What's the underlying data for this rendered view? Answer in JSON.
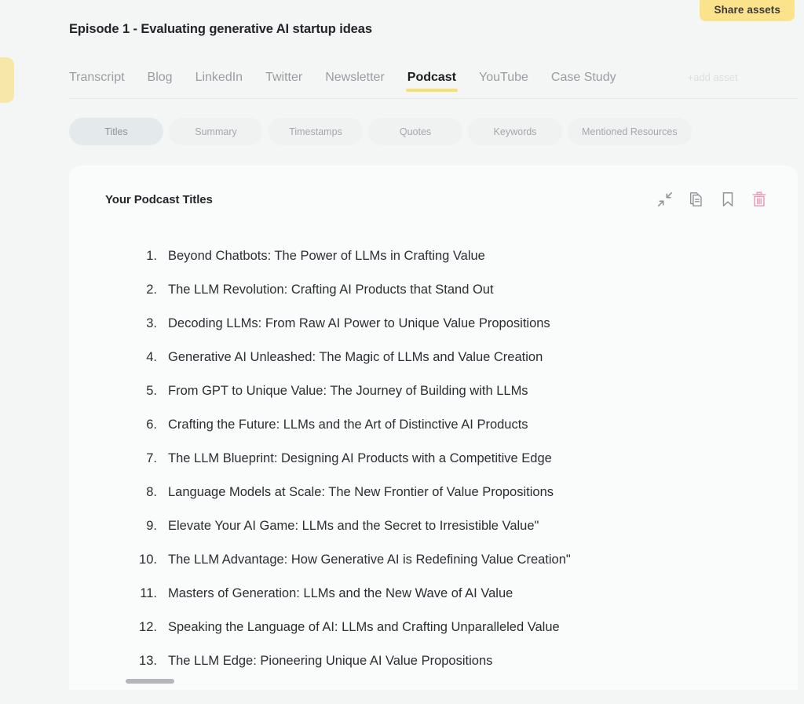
{
  "header": {
    "share_button_label": "Share assets",
    "episode_title": "Episode 1 - Evaluating generative AI startup ideas"
  },
  "asset_tabs": {
    "items": [
      {
        "label": "Transcript",
        "active": false
      },
      {
        "label": "Blog",
        "active": false
      },
      {
        "label": "LinkedIn",
        "active": false
      },
      {
        "label": "Twitter",
        "active": false
      },
      {
        "label": "Newsletter",
        "active": false
      },
      {
        "label": "Podcast",
        "active": true
      },
      {
        "label": "YouTube",
        "active": false
      },
      {
        "label": "Case Study",
        "active": false
      }
    ],
    "add_asset_label": "+add asset"
  },
  "sub_tabs": {
    "items": [
      {
        "label": "Titles",
        "active": true
      },
      {
        "label": "Summary",
        "active": false
      },
      {
        "label": "Timestamps",
        "active": false
      },
      {
        "label": "Quotes",
        "active": false
      },
      {
        "label": "Keywords",
        "active": false
      },
      {
        "label": "Mentioned Resources",
        "active": false
      }
    ]
  },
  "card": {
    "title": "Your Podcast Titles",
    "actions": [
      {
        "name": "collapse-icon",
        "label": "Collapse"
      },
      {
        "name": "copy-icon",
        "label": "Copy"
      },
      {
        "name": "bookmark-icon",
        "label": "Bookmark"
      },
      {
        "name": "trash-icon",
        "label": "Delete"
      }
    ],
    "titles": [
      "Beyond Chatbots: The Power of LLMs in Crafting Value",
      "The LLM Revolution: Crafting AI Products that Stand Out",
      "Decoding LLMs: From Raw AI Power to Unique Value Propositions",
      "Generative AI Unleashed: The Magic of LLMs and Value Creation",
      "From GPT to Unique Value: The Journey of Building with LLMs",
      "Crafting the Future: LLMs and the Art of Distinctive AI Products",
      "The LLM Blueprint: Designing AI Products with a Competitive Edge",
      "Language Models at Scale: The New Frontier of Value Propositions",
      "Elevate Your AI Game: LLMs and the Secret to Irresistible Value\"",
      "The LLM Advantage: How Generative AI is Redefining Value Creation\"",
      "Masters of Generation: LLMs and the New Wave of AI Value",
      "Speaking the Language of AI: LLMs and Crafting Unparalleled Value",
      "The LLM Edge: Pioneering Unique AI Value Propositions"
    ]
  },
  "colors": {
    "page_background": "#f4f5f5",
    "card_background": "#fafbfb",
    "accent_yellow": "#fbe38c",
    "underline_yellow": "#fcdf73",
    "active_pill": "#e4eaec",
    "inactive_pill": "#f0f1f1",
    "trash_pink": "#e79cb3",
    "icon_grey": "#8e9296"
  }
}
